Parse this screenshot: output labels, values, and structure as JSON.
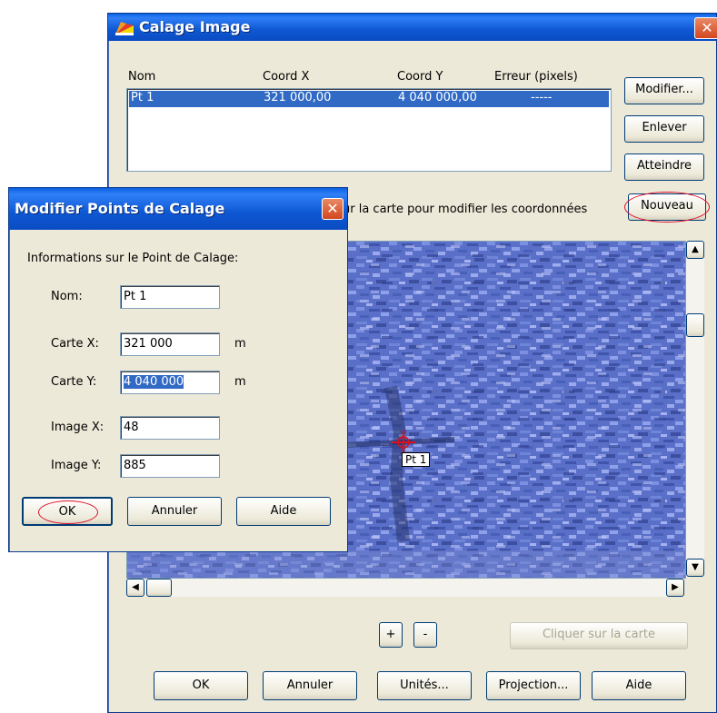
{
  "main_window": {
    "title": "Calage Image",
    "close_glyph": "✕",
    "table": {
      "columns": [
        "Nom",
        "Coord X",
        "Coord Y",
        "Erreur (pixels)"
      ],
      "rows": [
        {
          "nom": "Pt 1",
          "x": "321 000,00",
          "y": "4 040 000,00",
          "err": "-----"
        }
      ]
    },
    "buttons": {
      "modifier": "Modifier...",
      "enlever": "Enlever",
      "atteindre": "Atteindre",
      "nouveau": "Nouveau"
    },
    "instruction": "ur la carte pour modifier les coordonnées",
    "map": {
      "point_label": "Pt 1"
    },
    "zoom": {
      "plus": "+",
      "minus": "-"
    },
    "click_map": "Cliquer sur la carte",
    "footer": {
      "ok": "OK",
      "annuler": "Annuler",
      "unites": "Unités...",
      "projection": "Projection...",
      "aide": "Aide"
    }
  },
  "dialog": {
    "title": "Modifier Points de Calage",
    "close_glyph": "✕",
    "section": "Informations sur le Point de Calage:",
    "fields": {
      "nom": {
        "label": "Nom:",
        "value": "Pt 1"
      },
      "carte_x": {
        "label": "Carte X:",
        "value": "321 000",
        "unit": "m"
      },
      "carte_y": {
        "label": "Carte Y:",
        "value": "4 040 000",
        "unit": "m"
      },
      "image_x": {
        "label": "Image X:",
        "value": "48"
      },
      "image_y": {
        "label": "Image Y:",
        "value": "885"
      }
    },
    "buttons": {
      "ok": "OK",
      "annuler": "Annuler",
      "aide": "Aide"
    }
  },
  "colors": {
    "titlebar": "#0a55d6",
    "selection": "#316ac5",
    "annotation": "#e0102a",
    "map": "#5a6fc8"
  },
  "icons": {
    "app": "map-app-icon",
    "close": "close-icon"
  }
}
